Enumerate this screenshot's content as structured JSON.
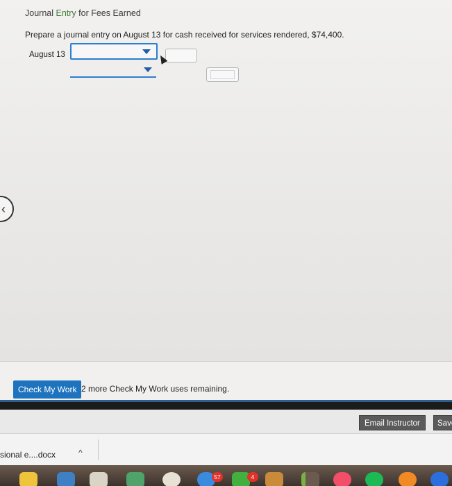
{
  "page": {
    "title_prefix": "Journal ",
    "title_accent": "Entry",
    "title_suffix": " for Fees Earned",
    "instructions": "Prepare a journal entry on August 13 for cash received for services rendered, $74,400.",
    "date_label": "August 13"
  },
  "check": {
    "button_label": "Check My Work",
    "remaining_text": "2 more Check My Work uses remaining."
  },
  "actions": {
    "email_label": "Email Instructor",
    "save_label": "Save"
  },
  "download": {
    "filename": "sional e....docx",
    "chevron": "^"
  },
  "dock": {
    "badges": [
      "57",
      "4"
    ]
  },
  "colors": {
    "accent_blue": "#1e73be",
    "dropdown_border": "#2a7fd0",
    "title_green": "#3f7a3a"
  }
}
